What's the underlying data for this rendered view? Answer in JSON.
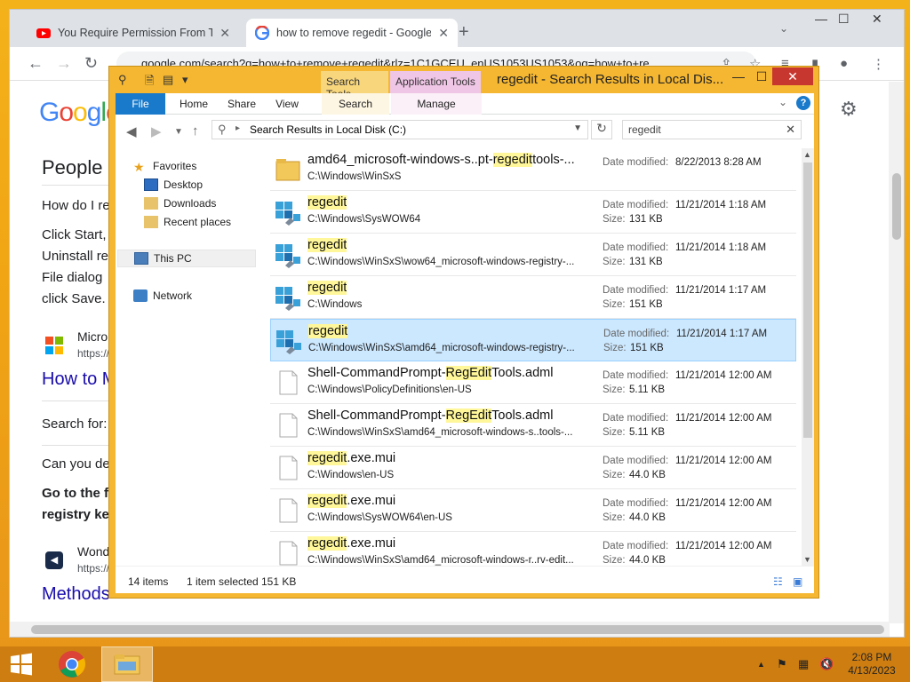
{
  "chrome": {
    "tabs": [
      {
        "title": "You Require Permission From Tru",
        "icon": "youtube-icon",
        "close": "✕"
      },
      {
        "title": "how to remove regedit - Google",
        "icon": "google-icon",
        "close": "✕"
      }
    ],
    "new_tab": "+",
    "tab_search": "⌄",
    "window_controls": {
      "minimize": "—",
      "maximize": "☐",
      "close": "✕"
    },
    "url": "google.com/search?q=how+to+remove+regedit&rlz=1C1GCEU_enUS1053US1053&oq=how+to+re...",
    "page": {
      "logo": "Google",
      "people_also_ask": "People a",
      "question1": "How do I re",
      "answer_lines": [
        "Click Start,",
        "Uninstall re",
        "File dialog",
        "click Save."
      ],
      "source1_name": "Micro",
      "source1_url": "https://",
      "link1": "How to M",
      "search_for": "Search for:",
      "question2": "Can you de",
      "bold_lines": [
        "Go to the f",
        "registry ke"
      ],
      "source2_name": "Wond",
      "source2_url": "https://",
      "link2": "Methods"
    }
  },
  "explorer": {
    "ribbon_context": {
      "search_tools": "Search Tools",
      "application_tools": "Application Tools"
    },
    "title": "regedit - Search Results in Local Dis...",
    "window_controls": {
      "minimize": "—",
      "maximize": "☐",
      "close": "✕"
    },
    "ribbon_tabs": {
      "file": "File",
      "home": "Home",
      "share": "Share",
      "view": "View",
      "search": "Search",
      "manage": "Manage"
    },
    "address": "Search Results in Local Disk (C:)",
    "search_value": "regedit",
    "nav": {
      "favorites": "Favorites",
      "desktop": "Desktop",
      "downloads": "Downloads",
      "recent": "Recent places",
      "this_pc": "This PC",
      "network": "Network"
    },
    "date_label": "Date modified:",
    "size_label": "Size:",
    "items": [
      {
        "pre": "amd64_microsoft-windows-s..pt-",
        "hl": "regedit",
        "post": "tools-...",
        "path": "C:\\Windows\\WinSxS",
        "date": "8/22/2013 8:28 AM",
        "size": "",
        "type": "folder"
      },
      {
        "pre": "",
        "hl": "regedit",
        "post": "",
        "path": "C:\\Windows\\SysWOW64",
        "date": "11/21/2014 1:18 AM",
        "size": "131 KB",
        "type": "app"
      },
      {
        "pre": "",
        "hl": "regedit",
        "post": "",
        "path": "C:\\Windows\\WinSxS\\wow64_microsoft-windows-registry-...",
        "date": "11/21/2014 1:18 AM",
        "size": "131 KB",
        "type": "app"
      },
      {
        "pre": "",
        "hl": "regedit",
        "post": "",
        "path": "C:\\Windows",
        "date": "11/21/2014 1:17 AM",
        "size": "151 KB",
        "type": "app"
      },
      {
        "pre": "",
        "hl": "regedit",
        "post": "",
        "path": "C:\\Windows\\WinSxS\\amd64_microsoft-windows-registry-...",
        "date": "11/21/2014 1:17 AM",
        "size": "151 KB",
        "type": "app",
        "selected": true
      },
      {
        "pre": "Shell-CommandPrompt-",
        "hl": "RegEdit",
        "post": "Tools.adml",
        "path": "C:\\Windows\\PolicyDefinitions\\en-US",
        "date": "11/21/2014 12:00 AM",
        "size": "5.11 KB",
        "type": "file"
      },
      {
        "pre": "Shell-CommandPrompt-",
        "hl": "RegEdit",
        "post": "Tools.adml",
        "path": "C:\\Windows\\WinSxS\\amd64_microsoft-windows-s..tools-...",
        "date": "11/21/2014 12:00 AM",
        "size": "5.11 KB",
        "type": "file"
      },
      {
        "pre": "",
        "hl": "regedit",
        "post": ".exe.mui",
        "path": "C:\\Windows\\en-US",
        "date": "11/21/2014 12:00 AM",
        "size": "44.0 KB",
        "type": "file"
      },
      {
        "pre": "",
        "hl": "regedit",
        "post": ".exe.mui",
        "path": "C:\\Windows\\SysWOW64\\en-US",
        "date": "11/21/2014 12:00 AM",
        "size": "44.0 KB",
        "type": "file"
      },
      {
        "pre": "",
        "hl": "regedit",
        "post": ".exe.mui",
        "path": "C:\\Windows\\WinSxS\\amd64_microsoft-windows-r..rv-edit...",
        "date": "11/21/2014 12:00 AM",
        "size": "44.0 KB",
        "type": "file"
      }
    ],
    "status": {
      "count": "14 items",
      "selected": "1 item selected",
      "size": "151 KB"
    }
  },
  "taskbar": {
    "time": "2:08 PM",
    "date": "4/13/2023"
  },
  "colors": {
    "accent": "#1979ca",
    "highlight": "#fff799",
    "selection": "#cce8ff"
  }
}
